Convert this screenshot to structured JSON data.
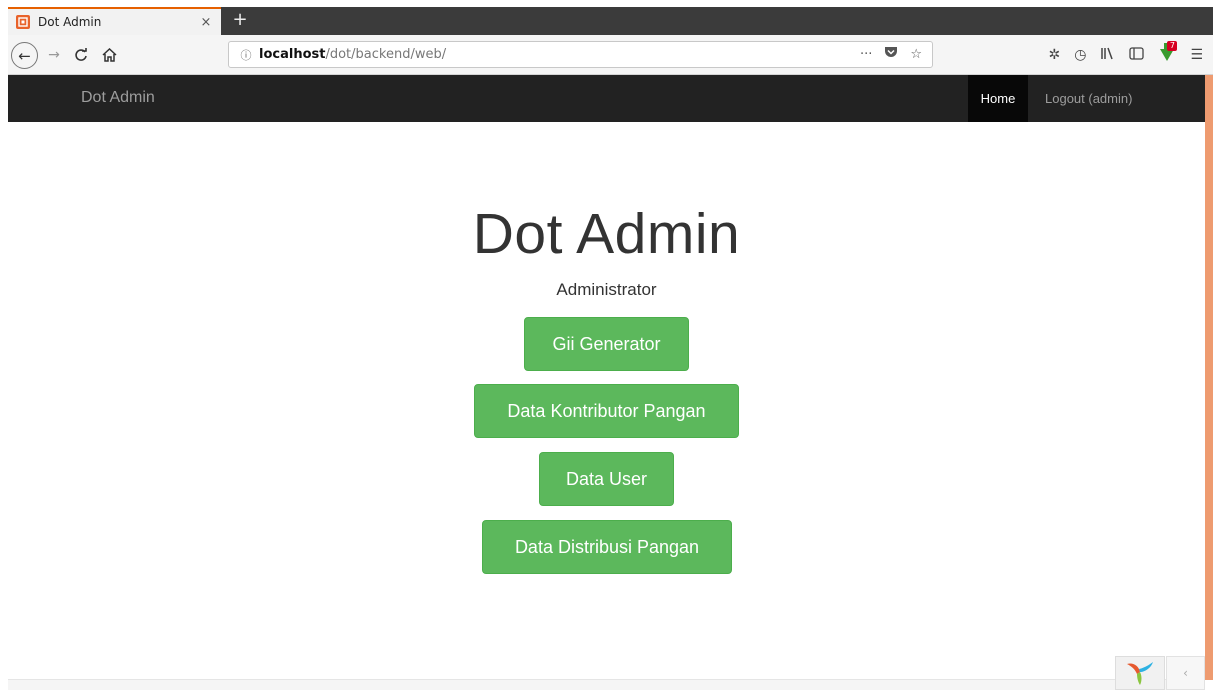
{
  "browser": {
    "tab_title": "Dot Admin",
    "tab_close": "×",
    "new_tab": "+",
    "url_host": "localhost",
    "url_path": "/dot/backend/web/",
    "icons": {
      "back": "back-arrow-icon",
      "forward": "forward-arrow-icon",
      "reload": "reload-icon",
      "home": "home-icon",
      "info": "info-icon",
      "more": "ellipsis-icon",
      "pocket": "pocket-icon",
      "bookmark": "star-icon",
      "extension": "gear-icon",
      "history": "clock-icon",
      "library": "library-icon",
      "sidebar": "sidebar-icon",
      "download": "download-icon",
      "menu": "hamburger-menu-icon"
    },
    "download_badge": "7",
    "accent_color": "#e66000"
  },
  "navbar": {
    "brand": "Dot Admin",
    "home": "Home",
    "logout": "Logout (admin)",
    "background": "#222222"
  },
  "main": {
    "title": "Dot Admin",
    "subtitle": "Administrator",
    "buttons": [
      {
        "label": "Gii Generator"
      },
      {
        "label": "Data Kontributor Pangan"
      },
      {
        "label": "Data User"
      },
      {
        "label": "Data Distribusi Pangan"
      }
    ],
    "button_color": "#5cb85c"
  },
  "debug_toolbar": {
    "logo": "yii-logo-icon",
    "toggle": "chevron-left-icon"
  }
}
